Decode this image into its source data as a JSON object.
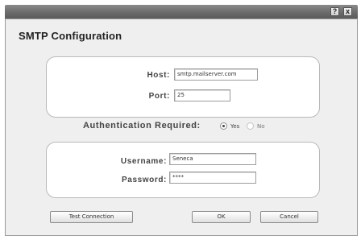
{
  "titlebar": {
    "help_label": "?",
    "close_label": "x"
  },
  "dialog": {
    "title": "SMTP Configuration"
  },
  "server": {
    "host_label": "Host:",
    "host_value": "smtp.mailserver.com",
    "port_label": "Port:",
    "port_value": "25"
  },
  "auth": {
    "label": "Authentication Required:",
    "yes_label": "Yes",
    "no_label": "No",
    "selected": "Yes"
  },
  "credentials": {
    "username_label": "Username:",
    "username_value": "Seneca",
    "password_label": "Password:",
    "password_value": "****"
  },
  "buttons": {
    "test_connection": "Test Connection",
    "ok": "OK",
    "cancel": "Cancel"
  }
}
